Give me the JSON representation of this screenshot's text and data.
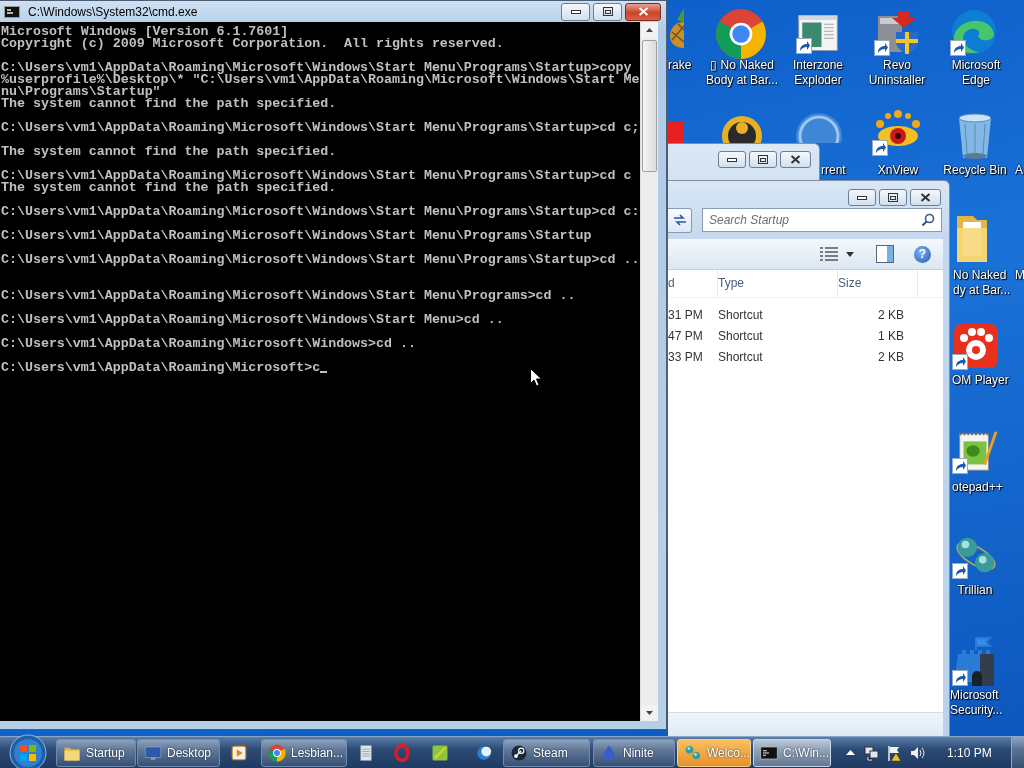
{
  "cmd_window": {
    "title": "C:\\Windows\\System32\\cmd.exe",
    "cursor_visible": true,
    "blocks": [
      {
        "extra_gap": false,
        "lines": [
          "Microsoft Windows [Version 6.1.7601]",
          "Copyright (c) 2009 Microsoft Corporation.  All rights reserved."
        ]
      },
      {
        "extra_gap": false,
        "lines": [
          "C:\\Users\\vm1\\AppData\\Roaming\\Microsoft\\Windows\\Start Menu\\Programs\\Startup>copy",
          "%userprofile%\\Desktop\\* \"C:\\Users\\vm1\\AppData\\Roaming\\Microsoft\\Windows\\Start Me",
          "nu\\Programs\\Startup\"",
          "The system cannot find the path specified."
        ]
      },
      {
        "extra_gap": false,
        "lines": [
          "C:\\Users\\vm1\\AppData\\Roaming\\Microsoft\\Windows\\Start Menu\\Programs\\Startup>cd c;"
        ]
      },
      {
        "extra_gap": false,
        "lines": [
          "The system cannot find the path specified."
        ]
      },
      {
        "extra_gap": false,
        "lines": [
          "C:\\Users\\vm1\\AppData\\Roaming\\Microsoft\\Windows\\Start Menu\\Programs\\Startup>cd c",
          "The system cannot find the path specified."
        ]
      },
      {
        "extra_gap": false,
        "lines": [
          "C:\\Users\\vm1\\AppData\\Roaming\\Microsoft\\Windows\\Start Menu\\Programs\\Startup>cd c:"
        ]
      },
      {
        "extra_gap": false,
        "lines": [
          "C:\\Users\\vm1\\AppData\\Roaming\\Microsoft\\Windows\\Start Menu\\Programs\\Startup"
        ]
      },
      {
        "extra_gap": false,
        "lines": [
          "C:\\Users\\vm1\\AppData\\Roaming\\Microsoft\\Windows\\Start Menu\\Programs\\Startup>cd .."
        ]
      },
      {
        "extra_gap": true,
        "lines": [
          "C:\\Users\\vm1\\AppData\\Roaming\\Microsoft\\Windows\\Start Menu\\Programs>cd .."
        ]
      },
      {
        "extra_gap": false,
        "lines": [
          "C:\\Users\\vm1\\AppData\\Roaming\\Microsoft\\Windows\\Start Menu>cd .."
        ]
      },
      {
        "extra_gap": false,
        "lines": [
          "C:\\Users\\vm1\\AppData\\Roaming\\Microsoft\\Windows>cd .."
        ]
      },
      {
        "extra_gap": false,
        "lines": [
          "C:\\Users\\vm1\\AppData\\Roaming\\Microsoft>c"
        ]
      }
    ]
  },
  "explorer_window": {
    "search": {
      "placeholder": "Search Startup"
    },
    "help": "?",
    "columns": [
      "d",
      "Type",
      "Size"
    ],
    "rows": [
      [
        "31 PM",
        "Shortcut",
        "2 KB"
      ],
      [
        "47 PM",
        "Shortcut",
        "1 KB"
      ],
      [
        "33 PM",
        "Shortcut",
        "2 KB"
      ]
    ]
  },
  "desktop_icons": [
    {
      "kind": "pineapple",
      "lines": [
        "rake"
      ],
      "shortcut": false
    },
    {
      "kind": "chrome",
      "lines": [
        "▯ No Naked",
        "Body at Bar..."
      ],
      "shortcut": false
    },
    {
      "kind": "window",
      "lines": [
        "Interzone",
        "Exploder"
      ],
      "shortcut": true
    },
    {
      "kind": "revo",
      "lines": [
        "Revo",
        "Uninstaller"
      ],
      "shortcut": true
    },
    {
      "kind": "edge",
      "lines": [
        "Microsoft",
        "Edge"
      ],
      "shortcut": true
    },
    {
      "kind": "red_block",
      "shortcut": false
    },
    {
      "kind": "yellow_circle",
      "shortcut": false
    },
    {
      "kind": "qb",
      "lines": [
        "rrent"
      ],
      "shortcut": false
    },
    {
      "kind": "xnview",
      "lines": [
        "XnView"
      ],
      "shortcut": true
    },
    {
      "kind": "recycle_bin",
      "lines": [
        "Recycle Bin"
      ],
      "shortcut": false
    },
    {
      "kind": "none",
      "lines": [
        "A"
      ]
    },
    {
      "kind": "folder",
      "lines": [
        "No Naked",
        "dy at Bar..."
      ],
      "shortcut": false
    },
    {
      "kind": "none",
      "lines": [
        "M"
      ]
    },
    {
      "kind": "gom",
      "lines": [
        "OM Player"
      ],
      "shortcut": true
    },
    {
      "kind": "notepad",
      "lines": [
        "otepad++"
      ],
      "shortcut": true
    },
    {
      "kind": "trillian",
      "lines": [
        "Trillian"
      ],
      "shortcut": true
    },
    {
      "kind": "castle",
      "lines": [
        "Microsoft",
        "Security..."
      ],
      "shortcut": true
    }
  ],
  "taskbar": {
    "items": [
      {
        "kind": "start"
      },
      {
        "kind": "folder",
        "label": "Startup",
        "active": false,
        "flashing": false
      },
      {
        "kind": "monitor",
        "label": "Desktop",
        "active": false,
        "flashing": false
      },
      {
        "kind": "media",
        "active": false,
        "flashing": false
      },
      {
        "kind": "chrome",
        "label": "Lesbian...",
        "active": false,
        "flashing": false
      },
      {
        "kind": "notepad",
        "active": false,
        "flashing": false
      },
      {
        "kind": "opera",
        "active": false,
        "flashing": false
      },
      {
        "kind": "tile",
        "active": false,
        "flashing": false
      },
      {
        "kind": "crescent",
        "active": false,
        "flashing": false
      },
      {
        "kind": "steam",
        "label": "Steam",
        "active": false,
        "flashing": false
      },
      {
        "kind": "ninite",
        "label": "Ninite",
        "active": false,
        "flashing": false
      },
      {
        "kind": "trillian",
        "label": "Welco...",
        "active": false,
        "flashing": true
      },
      {
        "kind": "cmd",
        "label": "C:\\Win...",
        "active": true,
        "flashing": false
      }
    ],
    "clock": "1:10 PM"
  }
}
